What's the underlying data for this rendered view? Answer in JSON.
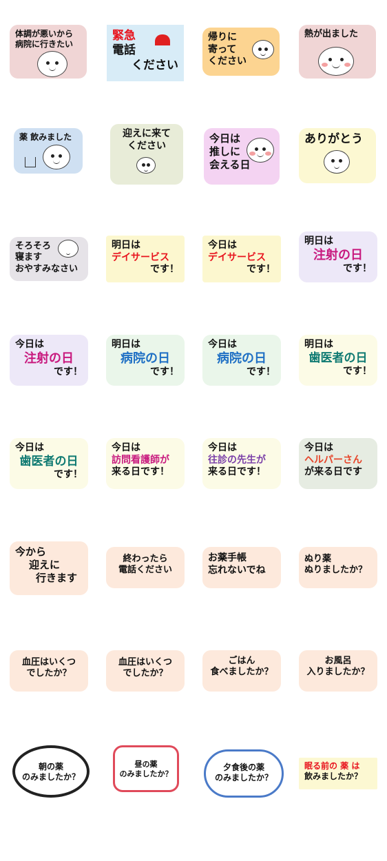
{
  "stickers": [
    {
      "lines": [
        "体調が悪いから",
        "病院に行きたい"
      ]
    },
    {
      "lines": [
        "緊急",
        "電話",
        "ください"
      ]
    },
    {
      "lines": [
        "帰りに",
        "寄って",
        "ください"
      ]
    },
    {
      "lines": [
        "熱が出ました"
      ]
    },
    {
      "lines": [
        "薬 飲みました"
      ]
    },
    {
      "lines": [
        "迎えに来て",
        "ください"
      ]
    },
    {
      "lines": [
        "今日は",
        "推しに",
        "会える日"
      ]
    },
    {
      "lines": [
        "ありがとう"
      ]
    },
    {
      "lines": [
        "そろそろ",
        "寝ます",
        "おやすみなさい"
      ]
    },
    {
      "lines": [
        "明日は",
        "デイサービス",
        "です！"
      ]
    },
    {
      "lines": [
        "今日は",
        "デイサービス",
        "です！"
      ]
    },
    {
      "lines": [
        "明日は",
        "注射の日",
        "です！"
      ]
    },
    {
      "lines": [
        "今日は",
        "注射の日",
        "です！"
      ]
    },
    {
      "lines": [
        "明日は",
        "病院の日",
        "です！"
      ]
    },
    {
      "lines": [
        "今日は",
        "病院の日",
        "です！"
      ]
    },
    {
      "lines": [
        "明日は",
        "歯医者の日",
        "です！"
      ]
    },
    {
      "lines": [
        "今日は",
        "歯医者の日",
        "です！"
      ]
    },
    {
      "lines": [
        "今日は",
        "訪問看護師が",
        "来る日です！"
      ]
    },
    {
      "lines": [
        "今日は",
        "往診の先生が",
        "来る日です！"
      ]
    },
    {
      "lines": [
        "今日は",
        "ヘルパーさん",
        "が来る日です"
      ]
    },
    {
      "lines": [
        "今から",
        "迎えに",
        "行きます"
      ]
    },
    {
      "lines": [
        "終わったら",
        "電話ください"
      ]
    },
    {
      "lines": [
        "お薬手帳",
        "忘れないでね"
      ]
    },
    {
      "lines": [
        "ぬり薬",
        "ぬりましたか？"
      ]
    },
    {
      "lines": [
        "血圧はいくつ",
        "でしたか？"
      ]
    },
    {
      "lines": [
        "血圧はいくつ",
        "でしたか？"
      ]
    },
    {
      "lines": [
        "ごはん",
        "食べましたか？"
      ]
    },
    {
      "lines": [
        "お風呂",
        "入りましたか？"
      ]
    },
    {
      "lines": [
        "朝の薬",
        "のみましたか？"
      ]
    },
    {
      "lines": [
        "昼の薬",
        "のみましたか？"
      ]
    },
    {
      "lines": [
        "夕食後の薬",
        "のみましたか？"
      ]
    },
    {
      "lines": [
        "眠る前の 薬 は",
        "飲みましたか？"
      ]
    }
  ],
  "colors": {
    "red": "#e8141e",
    "magenta": "#c8197e",
    "blue": "#1e6fc4",
    "teal": "#0f7a72",
    "purple": "#7a3fa8",
    "orangeRed": "#e6452a"
  }
}
